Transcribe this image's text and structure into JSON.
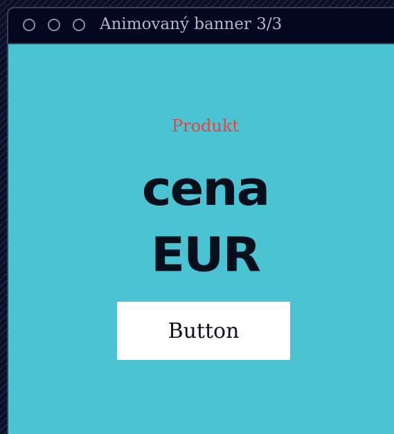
{
  "window": {
    "title": "Animovaný banner 3/3"
  },
  "banner": {
    "product": "Produkt",
    "headline_line1": "cena",
    "headline_line2": "EUR",
    "button_label": "Button"
  },
  "colors": {
    "banner_background": "#4cc3d2",
    "titlebar": "#030720",
    "product_text": "#e8443e",
    "headline_text": "#06101c",
    "button_background": "#ffffff"
  }
}
